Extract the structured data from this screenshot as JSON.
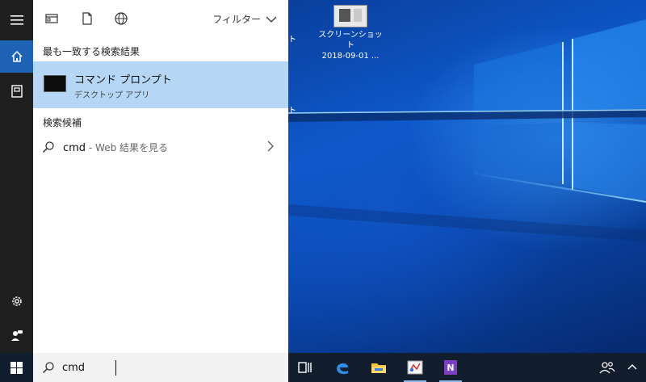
{
  "panel": {
    "filter_label": "フィルター",
    "best_match_header": "最も一致する検索結果",
    "best_match": {
      "title": "コマンド プロンプト",
      "subtitle": "デスクトップ アプリ"
    },
    "suggestions_header": "検索候補",
    "suggestion": {
      "query": "cmd",
      "rest": " - Web 結果を見る"
    }
  },
  "desktop": {
    "icon_label_1": "スクリーンショット",
    "icon_label_2": "2018-09-01 ..."
  },
  "search": {
    "value": "cmd"
  },
  "colors": {
    "accent": "#1e63b4",
    "highlight": "#b5d6f4",
    "rail": "#1f1f1f",
    "taskbar": "#121d2e"
  }
}
